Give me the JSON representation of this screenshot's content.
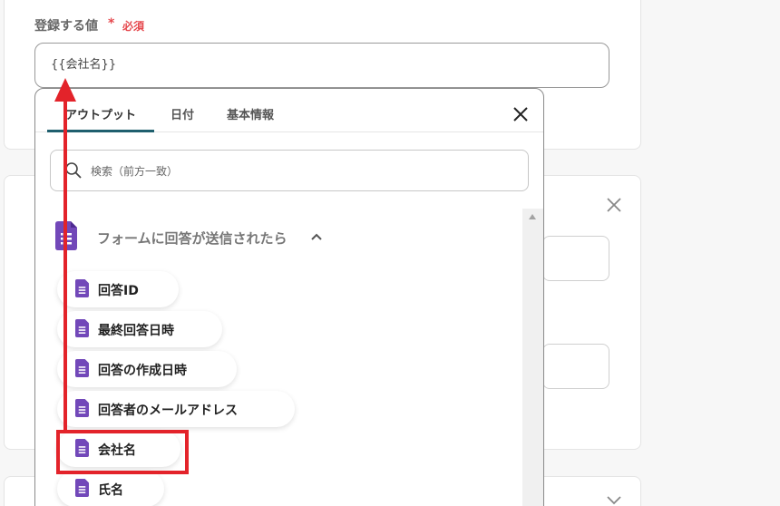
{
  "field": {
    "label": "登録する値",
    "required_star": "*",
    "required_text": "必須",
    "value": "{{会社名}}"
  },
  "popup": {
    "tabs": [
      {
        "label": "アウトプット",
        "active": true
      },
      {
        "label": "日付",
        "active": false
      },
      {
        "label": "基本情報",
        "active": false
      }
    ],
    "search_placeholder": "検索（前方一致）",
    "section": {
      "title": "フォームに回答が送信されたら",
      "icon": "google-forms-icon",
      "expanded": true
    },
    "items": [
      {
        "label": "回答ID",
        "icon": "google-forms-icon"
      },
      {
        "label": "最終回答日時",
        "icon": "google-forms-icon"
      },
      {
        "label": "回答の作成日時",
        "icon": "google-forms-icon"
      },
      {
        "label": "回答者のメールアドレス",
        "icon": "google-forms-icon"
      },
      {
        "label": "会社名",
        "icon": "google-forms-icon",
        "highlighted": true
      },
      {
        "label": "氏名",
        "icon": "google-forms-icon"
      }
    ]
  },
  "colors": {
    "accent_tab": "#1f5f6e",
    "required": "#e5484d",
    "annotation_red": "#e3232a",
    "forms_purple": "#7248b9"
  }
}
